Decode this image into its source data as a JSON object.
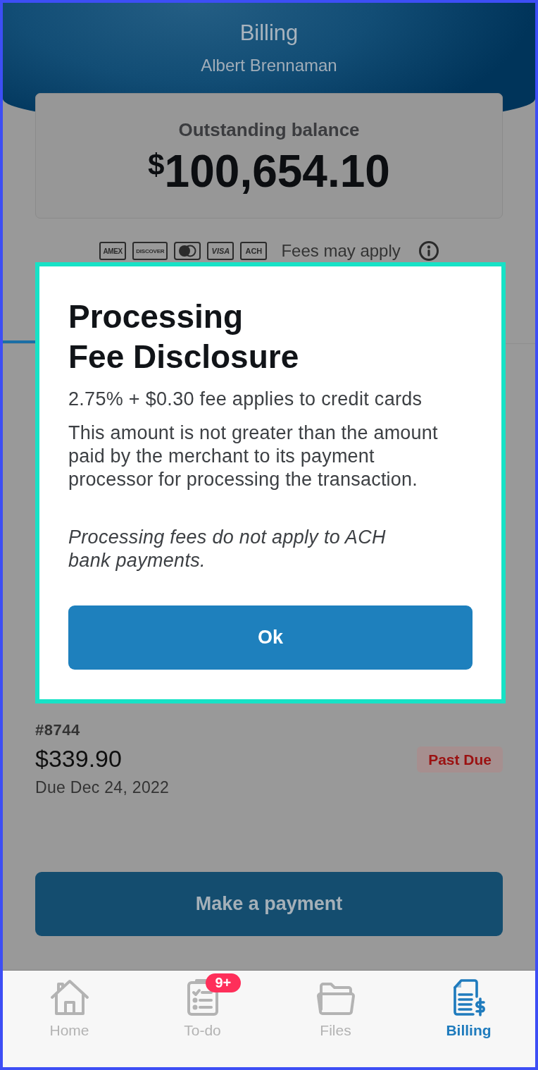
{
  "header": {
    "title": "Billing",
    "subtitle": "Albert Brennaman"
  },
  "balance": {
    "label": "Outstanding balance",
    "amount": "$^{$}$100,654.10"
  },
  "payment_methods": {
    "logos": [
      {
        "kind": "amex",
        "label": "AMEX"
      },
      {
        "kind": "discover",
        "label": "DISCOVER"
      },
      {
        "kind": "mastercard"
      },
      {
        "kind": "visa",
        "label": "VISA"
      },
      {
        "kind": "ach",
        "label": "ACH"
      }
    ],
    "note": "Fees may apply"
  },
  "invoice": {
    "number": "#8744",
    "amount": "$339.90",
    "due": "Due Dec 24, 2022",
    "status": "Past Due"
  },
  "primary_action": {
    "label": "Make a payment"
  },
  "bottom_nav": [
    {
      "kind": "home",
      "label": "Home",
      "selected": false
    },
    {
      "kind": "todo",
      "label": "To-do",
      "badge": "9+",
      "selected": false
    },
    {
      "kind": "files",
      "label": "Files",
      "selected": false
    },
    {
      "kind": "billing",
      "label": "Billing",
      "selected": true
    }
  ],
  "dialog": {
    "title": "Processing\nFee Disclosure",
    "fee": "2.75% + $0.30 fee applies to credit cards",
    "body": "This amount is not greater than the amount paid by the merchant to its payment processor for processing the transaction.",
    "note": "Processing fees do not apply to ACH bank payments.",
    "button": "Ok"
  }
}
